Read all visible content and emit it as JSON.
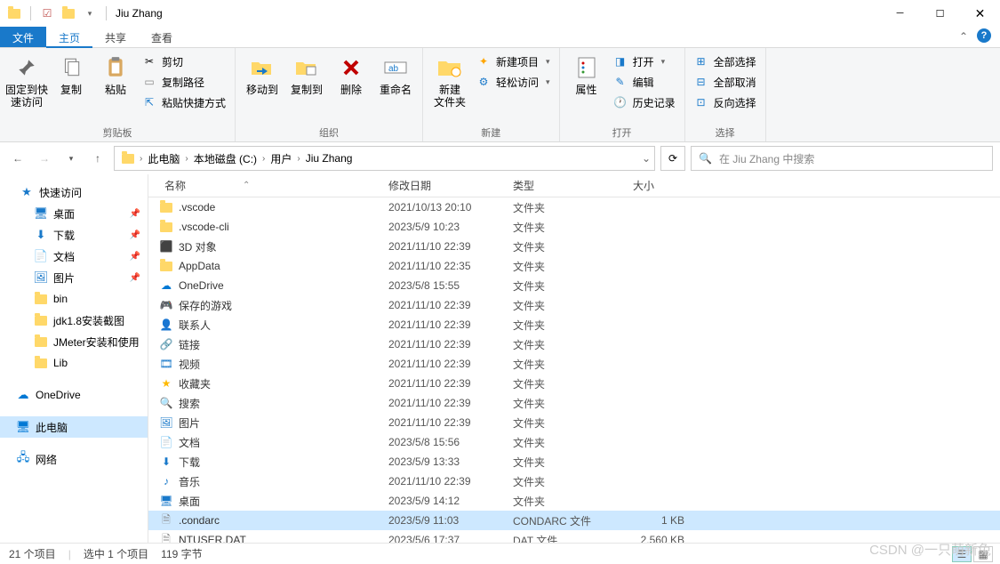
{
  "window": {
    "title": "Jiu Zhang"
  },
  "tabs": {
    "file": "文件",
    "items": [
      "主页",
      "共享",
      "查看"
    ],
    "active": 0
  },
  "ribbon": {
    "groups": {
      "clipboard": {
        "label": "剪贴板",
        "pin": "固定到快\n速访问",
        "copy": "复制",
        "paste": "粘贴",
        "cut": "剪切",
        "copypath": "复制路径",
        "pasteshortcut": "粘贴快捷方式"
      },
      "organize": {
        "label": "组织",
        "moveto": "移动到",
        "copyto": "复制到",
        "delete": "删除",
        "rename": "重命名"
      },
      "new": {
        "label": "新建",
        "newfolder": "新建\n文件夹",
        "newitem": "新建项目",
        "easyaccess": "轻松访问"
      },
      "open": {
        "label": "打开",
        "properties": "属性",
        "open": "打开",
        "edit": "编辑",
        "history": "历史记录"
      },
      "select": {
        "label": "选择",
        "selectall": "全部选择",
        "selectnone": "全部取消",
        "invert": "反向选择"
      }
    }
  },
  "breadcrumbs": [
    "此电脑",
    "本地磁盘 (C:)",
    "用户",
    "Jiu Zhang"
  ],
  "search": {
    "placeholder": "在 Jiu Zhang 中搜索"
  },
  "nav": {
    "quickaccess": "快速访问",
    "items": [
      {
        "name": "桌面",
        "pin": true,
        "icon": "desktop"
      },
      {
        "name": "下载",
        "pin": true,
        "icon": "downloads"
      },
      {
        "name": "文档",
        "pin": true,
        "icon": "documents"
      },
      {
        "name": "图片",
        "pin": true,
        "icon": "pictures"
      },
      {
        "name": "bin",
        "pin": false,
        "icon": "folder"
      },
      {
        "name": "jdk1.8安装截图",
        "pin": false,
        "icon": "folder"
      },
      {
        "name": "JMeter安装和使用",
        "pin": false,
        "icon": "folder"
      },
      {
        "name": "Lib",
        "pin": false,
        "icon": "folder"
      }
    ],
    "onedrive": "OneDrive",
    "thispc": "此电脑",
    "network": "网络"
  },
  "columns": {
    "name": "名称",
    "date": "修改日期",
    "type": "类型",
    "size": "大小"
  },
  "files": [
    {
      "name": ".vscode",
      "date": "2021/10/13 20:10",
      "type": "文件夹",
      "size": "",
      "icon": "folder"
    },
    {
      "name": ".vscode-cli",
      "date": "2023/5/9 10:23",
      "type": "文件夹",
      "size": "",
      "icon": "folder"
    },
    {
      "name": "3D 对象",
      "date": "2021/11/10 22:39",
      "type": "文件夹",
      "size": "",
      "icon": "3d"
    },
    {
      "name": "AppData",
      "date": "2021/11/10 22:35",
      "type": "文件夹",
      "size": "",
      "icon": "folder"
    },
    {
      "name": "OneDrive",
      "date": "2023/5/8 15:55",
      "type": "文件夹",
      "size": "",
      "icon": "onedrive"
    },
    {
      "name": "保存的游戏",
      "date": "2021/11/10 22:39",
      "type": "文件夹",
      "size": "",
      "icon": "games"
    },
    {
      "name": "联系人",
      "date": "2021/11/10 22:39",
      "type": "文件夹",
      "size": "",
      "icon": "contacts"
    },
    {
      "name": "链接",
      "date": "2021/11/10 22:39",
      "type": "文件夹",
      "size": "",
      "icon": "links"
    },
    {
      "name": "视频",
      "date": "2021/11/10 22:39",
      "type": "文件夹",
      "size": "",
      "icon": "videos"
    },
    {
      "name": "收藏夹",
      "date": "2021/11/10 22:39",
      "type": "文件夹",
      "size": "",
      "icon": "favorites"
    },
    {
      "name": "搜索",
      "date": "2021/11/10 22:39",
      "type": "文件夹",
      "size": "",
      "icon": "search"
    },
    {
      "name": "图片",
      "date": "2021/11/10 22:39",
      "type": "文件夹",
      "size": "",
      "icon": "pictures"
    },
    {
      "name": "文档",
      "date": "2023/5/8 15:56",
      "type": "文件夹",
      "size": "",
      "icon": "documents"
    },
    {
      "name": "下载",
      "date": "2023/5/9 13:33",
      "type": "文件夹",
      "size": "",
      "icon": "downloads"
    },
    {
      "name": "音乐",
      "date": "2021/11/10 22:39",
      "type": "文件夹",
      "size": "",
      "icon": "music"
    },
    {
      "name": "桌面",
      "date": "2023/5/9 14:12",
      "type": "文件夹",
      "size": "",
      "icon": "desktop"
    },
    {
      "name": ".condarc",
      "date": "2023/5/9 11:03",
      "type": "CONDARC 文件",
      "size": "1 KB",
      "icon": "file",
      "selected": true
    },
    {
      "name": "NTUSER.DAT",
      "date": "2023/5/6 17:37",
      "type": "DAT 文件",
      "size": "2,560 KB",
      "icon": "file"
    }
  ],
  "status": {
    "count": "21 个项目",
    "selected": "选中 1 个项目",
    "bytes": "119 字节"
  },
  "watermark": "CSDN @一只萌新兔"
}
